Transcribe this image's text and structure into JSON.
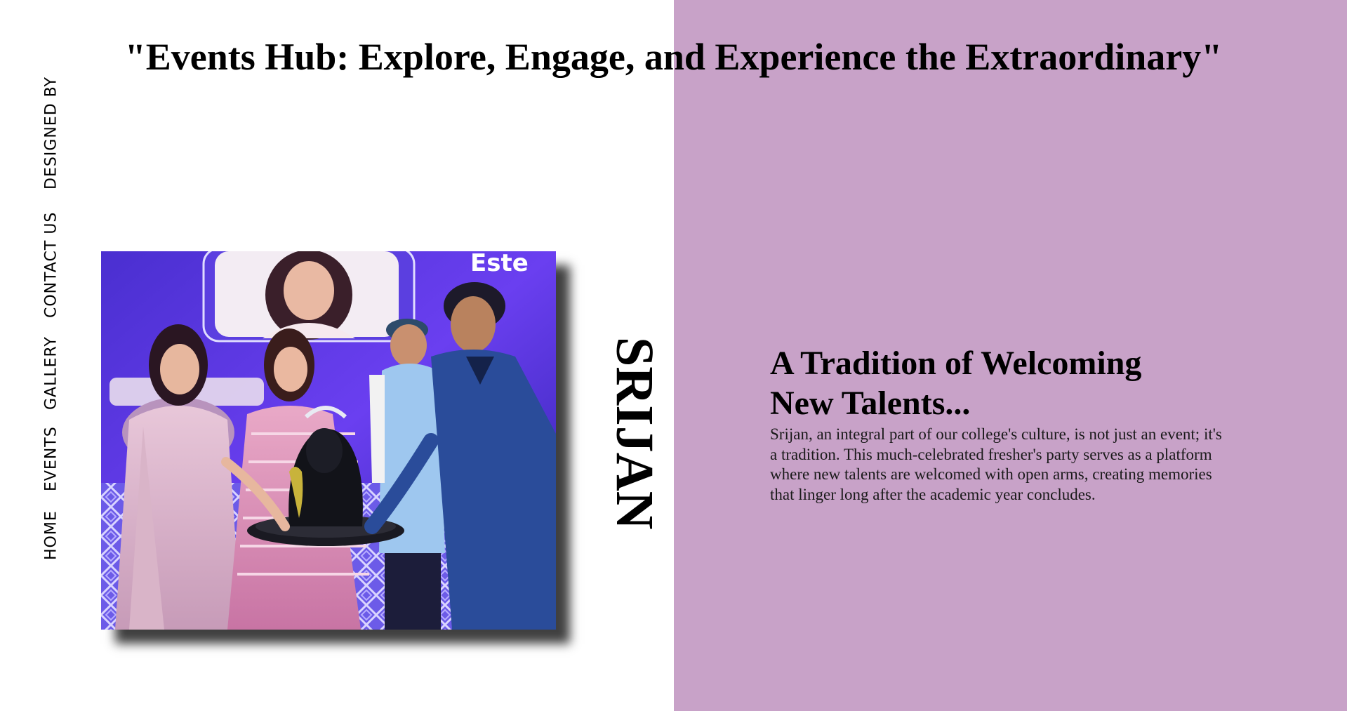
{
  "header": {
    "title": "\"Events Hub: Explore, Engage, and Experience the Extraordinary\""
  },
  "nav": {
    "items": [
      {
        "label": "HOME"
      },
      {
        "label": "EVENTS"
      },
      {
        "label": "GALLERY"
      },
      {
        "label": "CONTACT US"
      },
      {
        "label": "DESIGNED BY"
      }
    ]
  },
  "hero": {
    "image_alt": "Srijan event photo: four people presenting a statue trophy on stage",
    "image_caption_text": "Este",
    "vertical_label": "SRIJAN"
  },
  "content": {
    "heading": "A Tradition of Welcoming New Talents...",
    "paragraph": "Srijan, an integral part of our college's culture, is not just an event; it's a tradition. This much-celebrated fresher's party serves as a platform where new talents are welcomed with open arms, creating memories that linger long after the academic year concludes."
  },
  "colors": {
    "background": "#ffffff",
    "right_panel": "#c8a2c8",
    "text": "#000000"
  }
}
